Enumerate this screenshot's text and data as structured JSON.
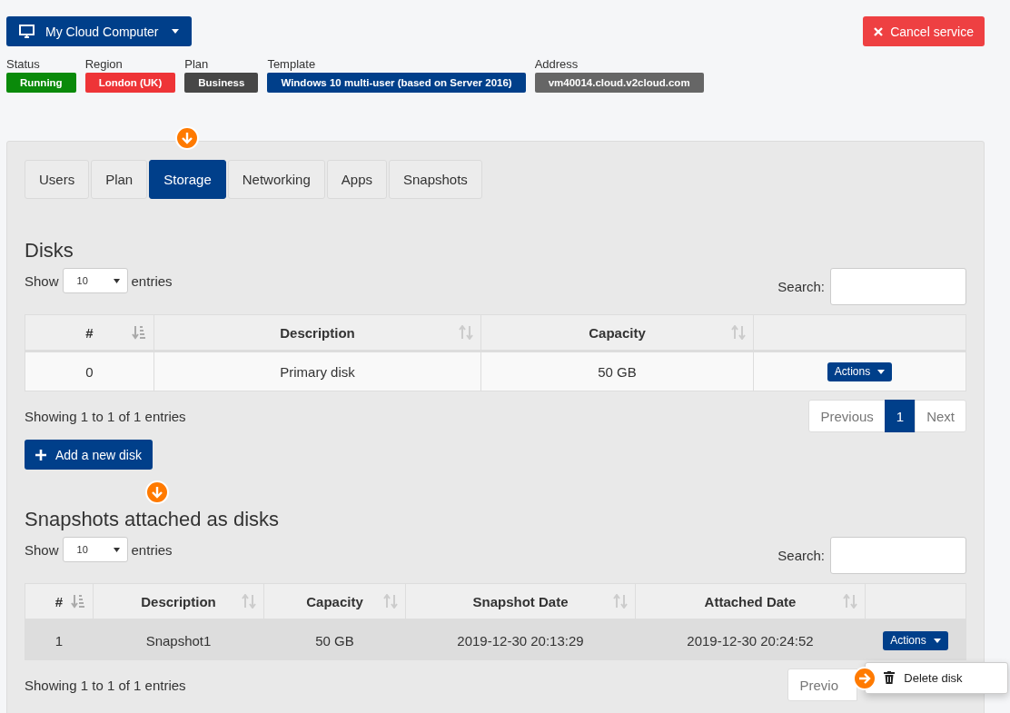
{
  "header": {
    "computer_button": "My Cloud Computer",
    "cancel_button": "Cancel service"
  },
  "info": [
    {
      "label": "Status",
      "value": "Running",
      "color": "#0a8a0a"
    },
    {
      "label": "Region",
      "value": "London (UK)",
      "color": "#ee3437"
    },
    {
      "label": "Plan",
      "value": "Business",
      "color": "#474747"
    },
    {
      "label": "Template",
      "value": "Windows 10 multi-user (based on Server 2016)",
      "color": "#003f8a"
    },
    {
      "label": "Address",
      "value": "vm40014.cloud.v2cloud.com",
      "color": "#666666"
    }
  ],
  "tabs": [
    {
      "label": "Users",
      "selected": false
    },
    {
      "label": "Plan",
      "selected": false
    },
    {
      "label": "Storage",
      "selected": true
    },
    {
      "label": "Networking",
      "selected": false
    },
    {
      "label": "Apps",
      "selected": false
    },
    {
      "label": "Snapshots",
      "selected": false
    }
  ],
  "sections": [
    {
      "title": "Disks",
      "show_label": "Show",
      "length_value": "10",
      "entries_label": "entries",
      "search_label": "Search:",
      "columns": [
        {
          "label": "#",
          "sortable": true,
          "sorted": true
        },
        {
          "label": "Description",
          "sortable": true,
          "sorted": false
        },
        {
          "label": "Capacity",
          "sortable": true,
          "sorted": false
        },
        {
          "sortable": false
        }
      ],
      "rows": [
        {
          "cells": [
            "0",
            "Primary disk",
            "50 GB"
          ],
          "action": "Actions",
          "selected": false
        }
      ],
      "summary": "Showing 1 to 1 of 1 entries",
      "pager": {
        "previous": "Previous",
        "pages": [
          {
            "label": "1",
            "selected": true
          }
        ],
        "next": "Next"
      },
      "add_button": "Add a new disk"
    },
    {
      "title": "Snapshots attached as disks",
      "show_label": "Show",
      "length_value": "10",
      "entries_label": "entries",
      "search_label": "Search:",
      "columns": [
        {
          "label": "#",
          "sortable": true,
          "sorted": true
        },
        {
          "label": "Description",
          "sortable": true,
          "sorted": false
        },
        {
          "label": "Capacity",
          "sortable": true,
          "sorted": false
        },
        {
          "label": "Snapshot Date",
          "sortable": true,
          "sorted": false
        },
        {
          "label": "Attached Date",
          "sortable": true,
          "sorted": false
        },
        {
          "sortable": false
        }
      ],
      "rows": [
        {
          "cells": [
            "1",
            "Snapshot1",
            "50 GB",
            "2019-12-30 20:13:29",
            "2019-12-30 20:24:52"
          ],
          "action": "Actions",
          "selected": true,
          "menu": [
            {
              "label": "Delete disk"
            }
          ]
        }
      ],
      "summary": "Showing 1 to 1 of 1 entries",
      "pager": {
        "previous": "Previo"
      }
    }
  ]
}
